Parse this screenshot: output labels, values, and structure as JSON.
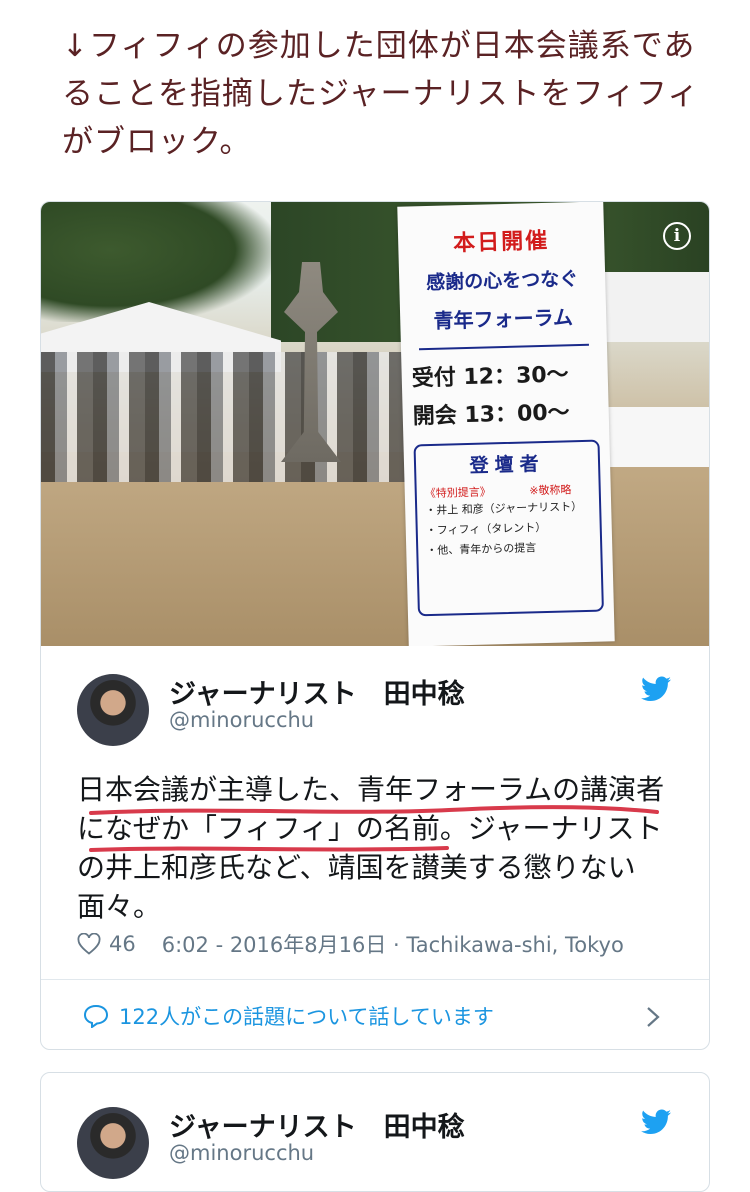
{
  "intro_text": "↓フィフィの参加した団体が日本会議系であることを指摘したジャーナリストをフィフィがブロック。",
  "photo": {
    "sign_line1": "本日開催",
    "sign_line2": "感謝の心をつなぐ",
    "sign_line3": "青年フォーラム",
    "sign_reception": "受付 12：30〜",
    "sign_opening": "開会 13：00〜",
    "sign_speakers_heading": "登壇者",
    "sign_special": "《特別提言》　　　　※敬称略",
    "sign_speaker1": "・井上 和彦（ジャーナリスト）",
    "sign_speaker2": "・フィフィ（タレント）",
    "sign_speaker3": "・他、青年からの提言",
    "info_icon": "i"
  },
  "tweet": {
    "author_name": "ジャーナリスト　田中稔",
    "handle": "@minorucchu",
    "text": "日本会議が主導した、青年フォーラムの講演者になぜか「フィフィ」の名前。ジャーナリストの井上和彦氏など、靖国を讃美する懲りない面々。",
    "likes": "46",
    "timestamp_location": "6:02 - 2016年8月16日 · Tachikawa-shi, Tokyo",
    "conversation": "122人がこの話題について話しています",
    "accent_color": "#1da1f2"
  },
  "tweet2": {
    "author_name": "ジャーナリスト　田中稔",
    "handle": "@minorucchu"
  }
}
